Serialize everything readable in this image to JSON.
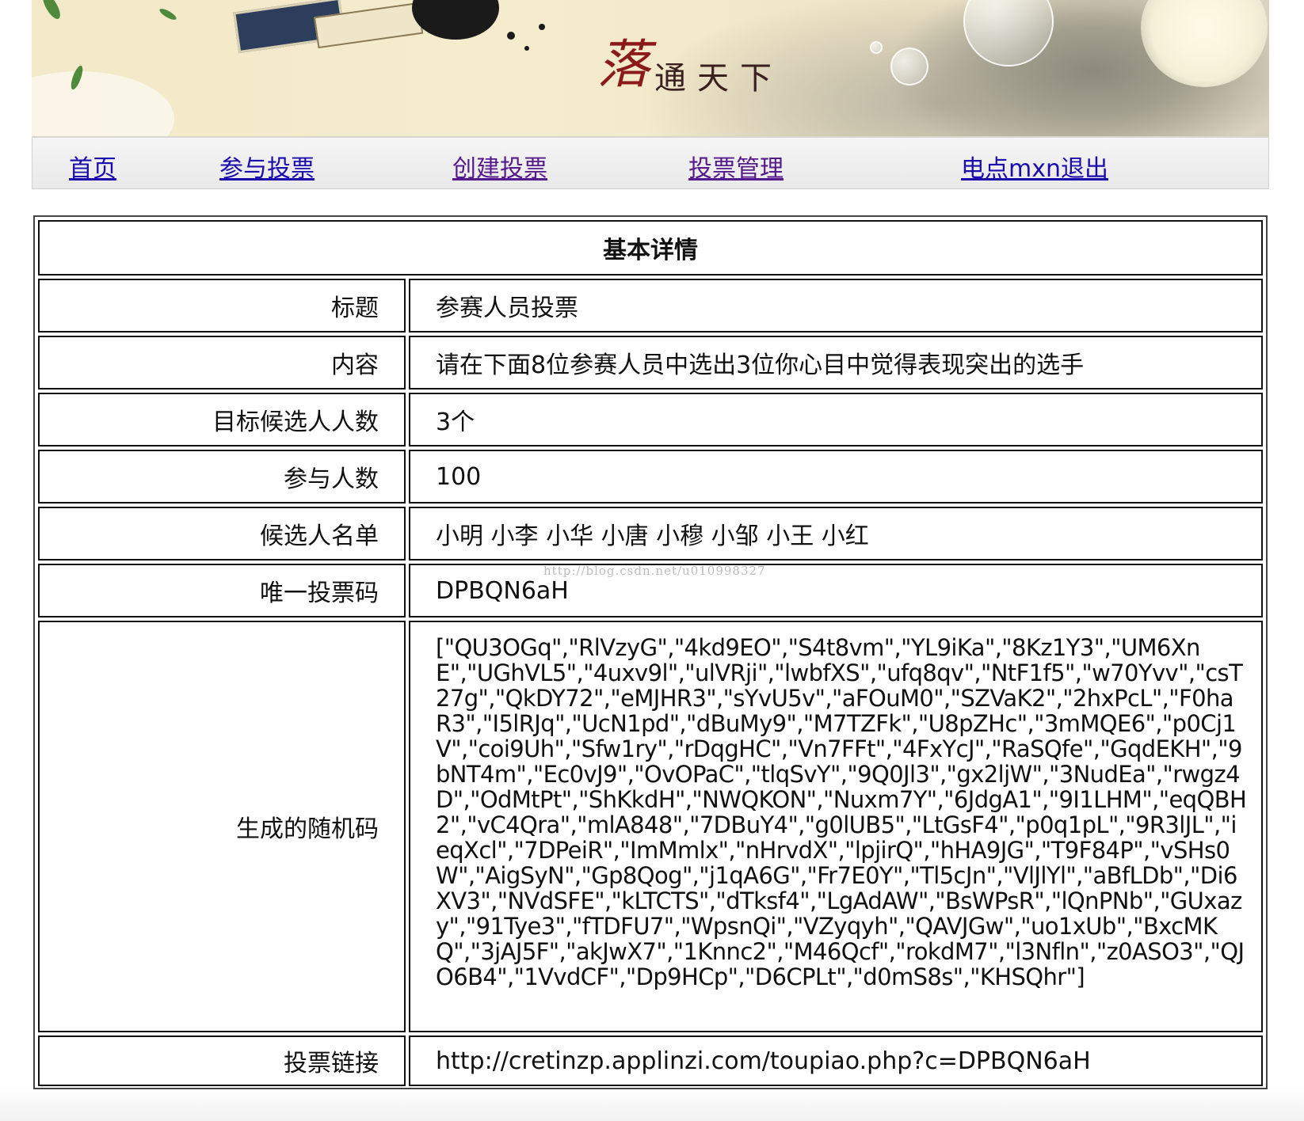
{
  "banner": {
    "title_big": "落",
    "title_small": "通天下"
  },
  "nav": {
    "home": "首页",
    "join_vote": "参与投票",
    "create_vote": "创建投票",
    "manage_vote": "投票管理",
    "logout": "电点mxn退出"
  },
  "detail": {
    "heading": "基本详情",
    "rows": [
      {
        "label": "标题",
        "value": "参赛人员投票"
      },
      {
        "label": "内容",
        "value": "请在下面8位参赛人员中选出3位你心目中觉得表现突出的选手"
      },
      {
        "label": "目标候选人人数",
        "value": "3个"
      },
      {
        "label": "参与人数",
        "value": "100"
      },
      {
        "label": "候选人名单",
        "value": "小明 小李 小华 小唐 小穆 小邹 小王 小红"
      },
      {
        "label": "唯一投票码",
        "value": "DPBQN6aH"
      },
      {
        "label": "生成的随机码",
        "value": "[\"QU3OGq\",\"RlVzyG\",\"4kd9EO\",\"S4t8vm\",\"YL9iKa\",\"8Kz1Y3\",\"UM6XnE\",\"UGhVL5\",\"4uxv9l\",\"ulVRji\",\"lwbfXS\",\"ufq8qv\",\"NtF1f5\",\"w70Yvv\",\"csT27g\",\"QkDY72\",\"eMJHR3\",\"sYvU5v\",\"aFOuM0\",\"SZVaK2\",\"2hxPcL\",\"F0haR3\",\"I5lRJq\",\"UcN1pd\",\"dBuMy9\",\"M7TZFk\",\"U8pZHc\",\"3mMQE6\",\"p0Cj1V\",\"coi9Uh\",\"Sfw1ry\",\"rDqgHC\",\"Vn7FFt\",\"4FxYcJ\",\"RaSQfe\",\"GqdEKH\",\"9bNT4m\",\"Ec0vJ9\",\"OvOPaC\",\"tlqSvY\",\"9Q0Jl3\",\"gx2ljW\",\"3NudEa\",\"rwgz4D\",\"OdMtPt\",\"ShKkdH\",\"NWQKON\",\"Nuxm7Y\",\"6JdgA1\",\"9I1LHM\",\"eqQBH2\",\"vC4Qra\",\"mlA848\",\"7DBuY4\",\"g0lUB5\",\"LtGsF4\",\"p0q1pL\",\"9R3lJL\",\"ieqXcl\",\"7DPeiR\",\"ImMmlx\",\"nHrvdX\",\"lpjirQ\",\"hHA9JG\",\"T9F84P\",\"vSHs0W\",\"AigSyN\",\"Gp8Qog\",\"j1qA6G\",\"Fr7E0Y\",\"Tl5cJn\",\"VlJlYl\",\"aBfLDb\",\"Di6XV3\",\"NVdSFE\",\"kLTCTS\",\"dTksf4\",\"LgAdAW\",\"BsWPsR\",\"lQnPNb\",\"GUxazy\",\"91Tye3\",\"fTDFU7\",\"WpsnQi\",\"VZyqyh\",\"QAVJGw\",\"uo1xUb\",\"BxcMKQ\",\"3jAJ5F\",\"akJwX7\",\"1Knnc2\",\"M46Qcf\",\"rokdM7\",\"l3Nfln\",\"z0ASO3\",\"QJO6B4\",\"1VvdCF\",\"Dp9HCp\",\"D6CPLt\",\"d0mS8s\",\"KHSQhr\"]"
      },
      {
        "label": "投票链接",
        "value": "http://cretinzp.applinzi.com/toupiao.php?c=DPBQN6aH"
      }
    ]
  },
  "watermark": "http://blog.csdn.net/u010998327",
  "colors": {
    "link": "#1a0dab",
    "visited_link": "#551a8b",
    "border": "#111111"
  }
}
